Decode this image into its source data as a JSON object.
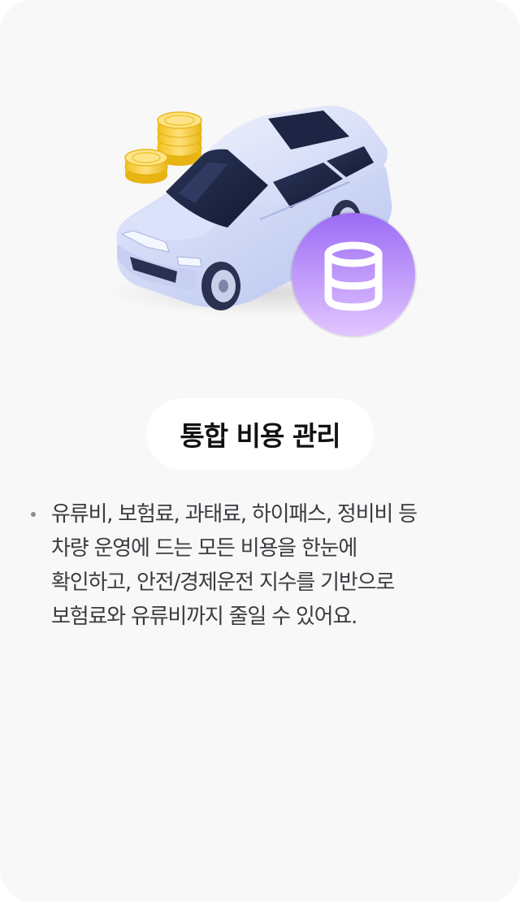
{
  "feature": {
    "title": "통합 비용 관리",
    "description_lines": [
      "유류비, 보험료, 과태료, 하이패스, 정비비 등",
      "차량 운영에 드는 모든 비용을 한눈에",
      "확인하고, 안전/경제운전 지수를 기반으로",
      "보험료와 유류비까지 줄일 수 있어요."
    ]
  },
  "illustration": {
    "icons": [
      "car-icon",
      "coin-stack-icon",
      "database-icon"
    ],
    "colors": {
      "car_body": "#c9d3f5",
      "coin": "#f6cf3a",
      "badge_start": "#9b6bf5",
      "badge_end": "#dcbcff"
    }
  }
}
